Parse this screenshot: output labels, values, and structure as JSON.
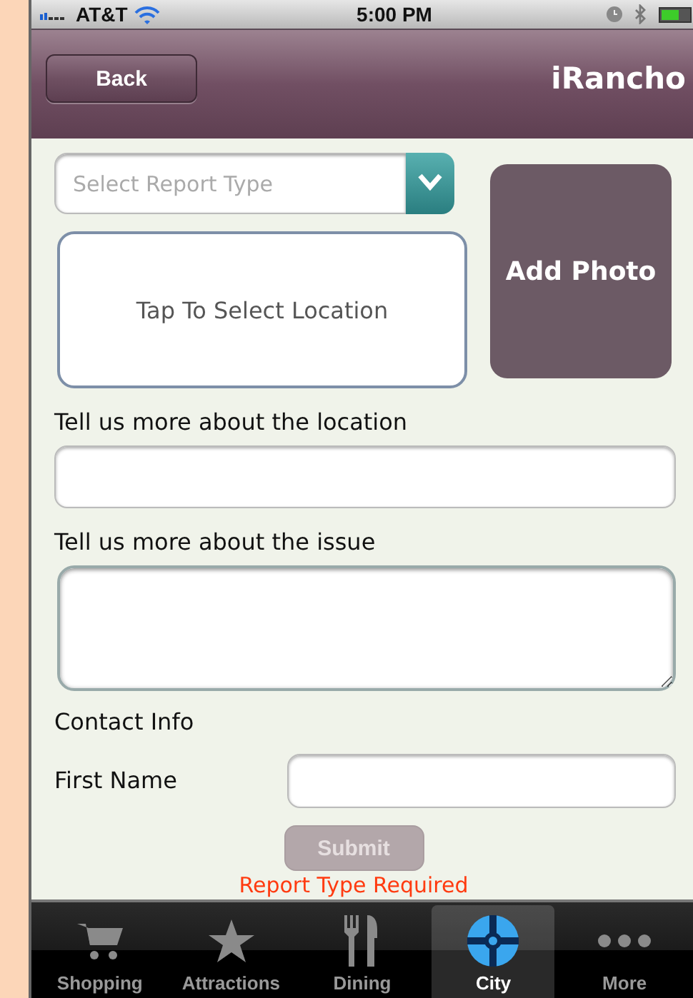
{
  "status_bar": {
    "carrier": "AT&T",
    "time": "5:00 PM"
  },
  "nav_bar": {
    "back": "Back",
    "title": "iRancho"
  },
  "form": {
    "report_type": {
      "placeholder": "Select Report Type"
    },
    "location_button": "Tap To Select Location",
    "add_photo_button": "Add Photo",
    "location_label": "Tell us more about the location",
    "issue_label": "Tell us more about the issue",
    "contact_heading": "Contact Info",
    "first_name_label": "First Name",
    "submit": {
      "label": "Submit",
      "disabled": true
    },
    "error": "Report Type Required"
  },
  "tabs": [
    {
      "label": "Shopping",
      "selected": false
    },
    {
      "label": "Attractions",
      "selected": false
    },
    {
      "label": "Dining",
      "selected": false
    },
    {
      "label": "City",
      "selected": true
    },
    {
      "label": "More",
      "selected": false
    }
  ]
}
